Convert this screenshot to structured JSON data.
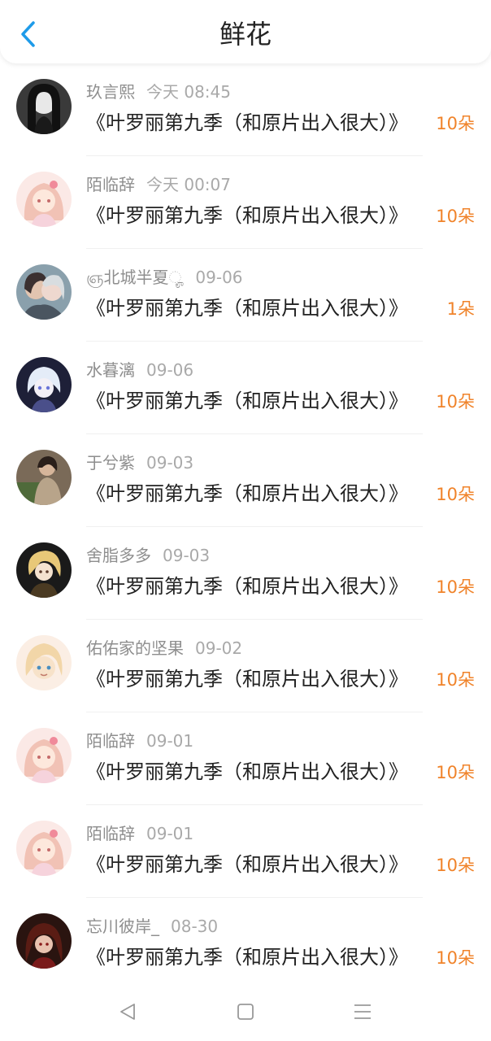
{
  "header": {
    "title": "鲜花",
    "back_icon": "chevron-left-icon"
  },
  "colors": {
    "accent_blue": "#1e9be9",
    "count_orange": "#f0832a",
    "name_gray": "#8e8e8e"
  },
  "records": [
    {
      "name": "玖言熙",
      "time": "今天 08:45",
      "message": "《叶罗丽第九季（和原片出入很大）》",
      "count": "10朵"
    },
    {
      "name": "陌临辞",
      "time": "今天 00:07",
      "message": "《叶罗丽第九季（和原片出入很大）》",
      "count": "10朵"
    },
    {
      "name": "ஞ北城半夏ೄ",
      "time": "09-06",
      "message": "《叶罗丽第九季（和原片出入很大）》",
      "count": "1朵"
    },
    {
      "name": "水暮漓",
      "time": "09-06",
      "message": "《叶罗丽第九季（和原片出入很大）》",
      "count": "10朵"
    },
    {
      "name": "于兮紫",
      "time": "09-03",
      "message": "《叶罗丽第九季（和原片出入很大）》",
      "count": "10朵"
    },
    {
      "name": "舍脂多多",
      "time": "09-03",
      "message": "《叶罗丽第九季（和原片出入很大）》",
      "count": "10朵"
    },
    {
      "name": "佑佑家的坚果",
      "time": "09-02",
      "message": "《叶罗丽第九季（和原片出入很大）》",
      "count": "10朵"
    },
    {
      "name": "陌临辞",
      "time": "09-01",
      "message": "《叶罗丽第九季（和原片出入很大）》",
      "count": "10朵"
    },
    {
      "name": "陌临辞",
      "time": "09-01",
      "message": "《叶罗丽第九季（和原片出入很大）》",
      "count": "10朵"
    },
    {
      "name": "忘川彼岸_",
      "time": "08-30",
      "message": "《叶罗丽第九季（和原片出入很大）》",
      "count": "10朵"
    }
  ],
  "navbar": {
    "back": "triangle-back-icon",
    "home": "square-home-icon",
    "menu": "menu-lines-icon"
  }
}
